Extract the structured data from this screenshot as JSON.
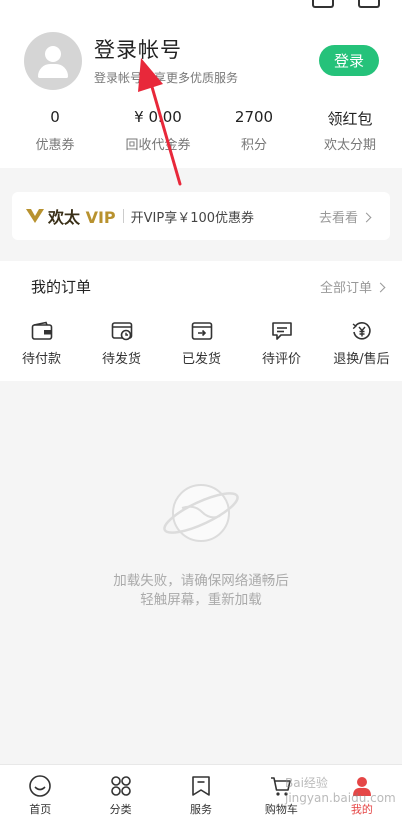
{
  "profile": {
    "title": "登录帐号",
    "subtitle": "登录帐号畅享更多优质服务",
    "login_button": "登录"
  },
  "stats": [
    {
      "value": "0",
      "label": "优惠券"
    },
    {
      "value": "¥ 0.00",
      "label": "回收代金券"
    },
    {
      "value": "2700",
      "label": "积分"
    },
    {
      "value": "领红包",
      "label": "欢太分期"
    }
  ],
  "vip": {
    "brand_a": "欢太",
    "brand_b": "VIP",
    "text": "开VIP享￥100优惠券",
    "more": "去看看"
  },
  "orders": {
    "title": "我的订单",
    "all": "全部订单",
    "items": [
      {
        "label": "待付款",
        "icon": "wallet-icon"
      },
      {
        "label": "待发货",
        "icon": "box-clock-icon"
      },
      {
        "label": "已发货",
        "icon": "shipped-box-icon"
      },
      {
        "label": "待评价",
        "icon": "comment-icon"
      },
      {
        "label": "退换/售后",
        "icon": "refund-icon"
      }
    ]
  },
  "empty": {
    "line1": "加载失败，请确保网络通畅后",
    "line2": "轻触屏幕，重新加载"
  },
  "tabs": [
    {
      "label": "首页",
      "icon": "home-icon"
    },
    {
      "label": "分类",
      "icon": "category-icon"
    },
    {
      "label": "服务",
      "icon": "service-icon"
    },
    {
      "label": "购物车",
      "icon": "cart-icon"
    },
    {
      "label": "我的",
      "icon": "profile-icon",
      "active": true
    }
  ],
  "watermark": "Bai经验 jingyan.baidu.com",
  "colors": {
    "accent_green": "#25c27a",
    "vip_gold": "#b8922f",
    "active_red": "#e54646",
    "annotation_red": "#e8283a"
  }
}
